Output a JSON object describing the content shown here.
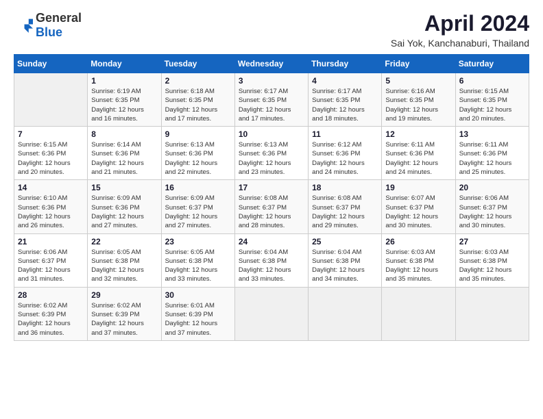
{
  "header": {
    "logo_general": "General",
    "logo_blue": "Blue",
    "title": "April 2024",
    "subtitle": "Sai Yok, Kanchanaburi, Thailand"
  },
  "calendar": {
    "weekdays": [
      "Sunday",
      "Monday",
      "Tuesday",
      "Wednesday",
      "Thursday",
      "Friday",
      "Saturday"
    ],
    "weeks": [
      [
        {
          "day": "",
          "info": ""
        },
        {
          "day": "1",
          "info": "Sunrise: 6:19 AM\nSunset: 6:35 PM\nDaylight: 12 hours\nand 16 minutes."
        },
        {
          "day": "2",
          "info": "Sunrise: 6:18 AM\nSunset: 6:35 PM\nDaylight: 12 hours\nand 17 minutes."
        },
        {
          "day": "3",
          "info": "Sunrise: 6:17 AM\nSunset: 6:35 PM\nDaylight: 12 hours\nand 17 minutes."
        },
        {
          "day": "4",
          "info": "Sunrise: 6:17 AM\nSunset: 6:35 PM\nDaylight: 12 hours\nand 18 minutes."
        },
        {
          "day": "5",
          "info": "Sunrise: 6:16 AM\nSunset: 6:35 PM\nDaylight: 12 hours\nand 19 minutes."
        },
        {
          "day": "6",
          "info": "Sunrise: 6:15 AM\nSunset: 6:35 PM\nDaylight: 12 hours\nand 20 minutes."
        }
      ],
      [
        {
          "day": "7",
          "info": "Sunrise: 6:15 AM\nSunset: 6:36 PM\nDaylight: 12 hours\nand 20 minutes."
        },
        {
          "day": "8",
          "info": "Sunrise: 6:14 AM\nSunset: 6:36 PM\nDaylight: 12 hours\nand 21 minutes."
        },
        {
          "day": "9",
          "info": "Sunrise: 6:13 AM\nSunset: 6:36 PM\nDaylight: 12 hours\nand 22 minutes."
        },
        {
          "day": "10",
          "info": "Sunrise: 6:13 AM\nSunset: 6:36 PM\nDaylight: 12 hours\nand 23 minutes."
        },
        {
          "day": "11",
          "info": "Sunrise: 6:12 AM\nSunset: 6:36 PM\nDaylight: 12 hours\nand 24 minutes."
        },
        {
          "day": "12",
          "info": "Sunrise: 6:11 AM\nSunset: 6:36 PM\nDaylight: 12 hours\nand 24 minutes."
        },
        {
          "day": "13",
          "info": "Sunrise: 6:11 AM\nSunset: 6:36 PM\nDaylight: 12 hours\nand 25 minutes."
        }
      ],
      [
        {
          "day": "14",
          "info": "Sunrise: 6:10 AM\nSunset: 6:36 PM\nDaylight: 12 hours\nand 26 minutes."
        },
        {
          "day": "15",
          "info": "Sunrise: 6:09 AM\nSunset: 6:36 PM\nDaylight: 12 hours\nand 27 minutes."
        },
        {
          "day": "16",
          "info": "Sunrise: 6:09 AM\nSunset: 6:37 PM\nDaylight: 12 hours\nand 27 minutes."
        },
        {
          "day": "17",
          "info": "Sunrise: 6:08 AM\nSunset: 6:37 PM\nDaylight: 12 hours\nand 28 minutes."
        },
        {
          "day": "18",
          "info": "Sunrise: 6:08 AM\nSunset: 6:37 PM\nDaylight: 12 hours\nand 29 minutes."
        },
        {
          "day": "19",
          "info": "Sunrise: 6:07 AM\nSunset: 6:37 PM\nDaylight: 12 hours\nand 30 minutes."
        },
        {
          "day": "20",
          "info": "Sunrise: 6:06 AM\nSunset: 6:37 PM\nDaylight: 12 hours\nand 30 minutes."
        }
      ],
      [
        {
          "day": "21",
          "info": "Sunrise: 6:06 AM\nSunset: 6:37 PM\nDaylight: 12 hours\nand 31 minutes."
        },
        {
          "day": "22",
          "info": "Sunrise: 6:05 AM\nSunset: 6:38 PM\nDaylight: 12 hours\nand 32 minutes."
        },
        {
          "day": "23",
          "info": "Sunrise: 6:05 AM\nSunset: 6:38 PM\nDaylight: 12 hours\nand 33 minutes."
        },
        {
          "day": "24",
          "info": "Sunrise: 6:04 AM\nSunset: 6:38 PM\nDaylight: 12 hours\nand 33 minutes."
        },
        {
          "day": "25",
          "info": "Sunrise: 6:04 AM\nSunset: 6:38 PM\nDaylight: 12 hours\nand 34 minutes."
        },
        {
          "day": "26",
          "info": "Sunrise: 6:03 AM\nSunset: 6:38 PM\nDaylight: 12 hours\nand 35 minutes."
        },
        {
          "day": "27",
          "info": "Sunrise: 6:03 AM\nSunset: 6:38 PM\nDaylight: 12 hours\nand 35 minutes."
        }
      ],
      [
        {
          "day": "28",
          "info": "Sunrise: 6:02 AM\nSunset: 6:39 PM\nDaylight: 12 hours\nand 36 minutes."
        },
        {
          "day": "29",
          "info": "Sunrise: 6:02 AM\nSunset: 6:39 PM\nDaylight: 12 hours\nand 37 minutes."
        },
        {
          "day": "30",
          "info": "Sunrise: 6:01 AM\nSunset: 6:39 PM\nDaylight: 12 hours\nand 37 minutes."
        },
        {
          "day": "",
          "info": ""
        },
        {
          "day": "",
          "info": ""
        },
        {
          "day": "",
          "info": ""
        },
        {
          "day": "",
          "info": ""
        }
      ]
    ]
  }
}
